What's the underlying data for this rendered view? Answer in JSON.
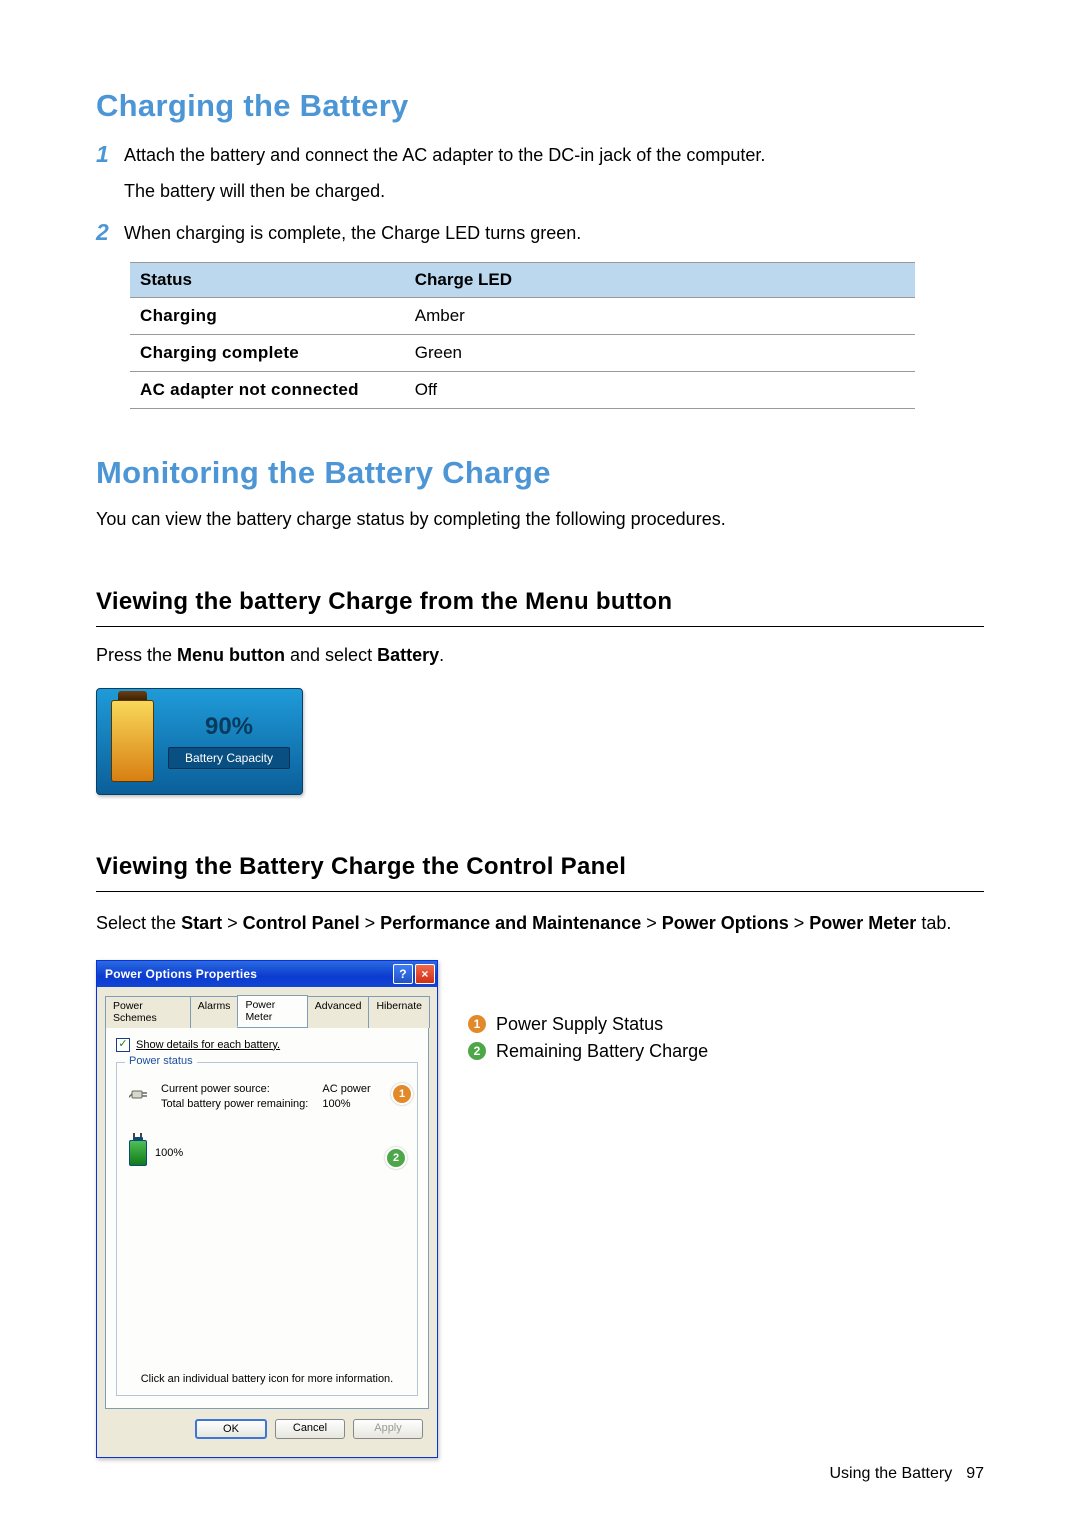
{
  "section1": {
    "title": "Charging the Battery",
    "steps": [
      "Attach the battery and connect the AC adapter to the DC-in jack of the computer.",
      "When charging is complete, the Charge LED turns green."
    ],
    "step1_sub": "The battery will then be charged."
  },
  "chart_data": {
    "type": "table",
    "title": "Charge LED status",
    "columns": [
      "Status",
      "Charge LED"
    ],
    "rows": [
      [
        "Charging",
        "Amber"
      ],
      [
        "Charging complete",
        "Green"
      ],
      [
        "AC adapter not connected",
        "Off"
      ]
    ]
  },
  "section2": {
    "title": "Monitoring the Battery Charge",
    "intro": "You can view the battery charge status by completing the following procedures."
  },
  "subA": {
    "title": "Viewing the battery Charge from the Menu button",
    "text_pre": "Press the ",
    "text_b1": "Menu button",
    "text_mid": " and select ",
    "text_b2": "Battery",
    "text_post": "."
  },
  "battery_widget": {
    "percent": "90%",
    "label": "Battery Capacity"
  },
  "subB": {
    "title": "Viewing the Battery Charge the Control Panel",
    "path_pre": "Select the ",
    "path_b1": "Start",
    "sep": " > ",
    "path_b2": "Control Panel",
    "path_b3": "Performance and Maintenance",
    "path_b4": "Power Options",
    "path_b5": "Power Meter",
    "tab_word": " tab."
  },
  "dialog": {
    "title": "Power Options Properties",
    "tabs": [
      "Power Schemes",
      "Alarms",
      "Power Meter",
      "Advanced",
      "Hibernate"
    ],
    "active_tab_index": 2,
    "checkbox_label": "Show details for each battery.",
    "groupbox_legend": "Power status",
    "kv": [
      [
        "Current power source:",
        "AC power"
      ],
      [
        "Total battery power remaining:",
        "100%"
      ]
    ],
    "battery_small_percent": "100%",
    "footer_hint": "Click an individual battery icon for more information.",
    "buttons": {
      "ok": "OK",
      "cancel": "Cancel",
      "apply": "Apply"
    },
    "annot": {
      "one": "1",
      "two": "2"
    }
  },
  "legend": {
    "items": [
      {
        "num": "1",
        "text": "Power Supply Status"
      },
      {
        "num": "2",
        "text": "Remaining Battery Charge"
      }
    ]
  },
  "footer": {
    "text": "Using the Battery",
    "page": "97"
  }
}
